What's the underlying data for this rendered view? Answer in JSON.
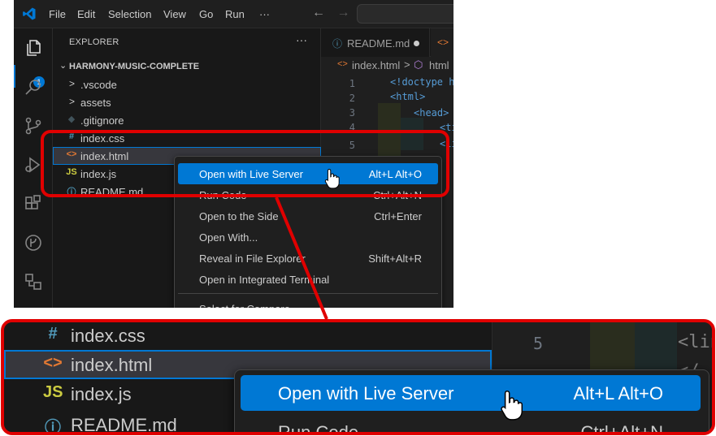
{
  "app": {
    "name": "Visual Studio Code"
  },
  "menubar": {
    "items": [
      {
        "label": "File"
      },
      {
        "label": "Edit"
      },
      {
        "label": "Selection"
      },
      {
        "label": "View"
      },
      {
        "label": "Go"
      },
      {
        "label": "Run"
      },
      {
        "label": "···"
      }
    ],
    "nav_back": "←",
    "nav_forward": "→"
  },
  "activitybar": {
    "icons": [
      "explorer-icon",
      "search-icon",
      "source-control-icon",
      "run-debug-icon",
      "extensions-icon",
      "remote-icon",
      "accounts-icon"
    ],
    "badge": "1"
  },
  "explorer": {
    "title": "EXPLORER",
    "more": "···",
    "project": "HARMONY-MUSIC-COMPLETE",
    "items": [
      {
        "name": ".vscode",
        "kind": "folder",
        "icon": ">",
        "color": "#cccccc"
      },
      {
        "name": "assets",
        "kind": "folder",
        "icon": ">",
        "color": "#cccccc"
      },
      {
        "name": ".gitignore",
        "kind": "file",
        "icon": "◆",
        "color": "#41535b"
      },
      {
        "name": "index.css",
        "kind": "file",
        "icon": "#",
        "color": "#519aba"
      },
      {
        "name": "index.html",
        "kind": "file",
        "icon": "<>",
        "color": "#e37933",
        "selected": true
      },
      {
        "name": "index.js",
        "kind": "file",
        "icon": "JS",
        "color": "#cbcb41"
      },
      {
        "name": "README.md",
        "kind": "file",
        "icon": "ⓘ",
        "color": "#519aba"
      }
    ]
  },
  "editor": {
    "tabs": [
      {
        "label": "README.md",
        "icon": "ⓘ",
        "modified": true
      },
      {
        "label": "",
        "icon": "<>"
      }
    ],
    "breadcrumb": {
      "file": "index.html",
      "separator": ">",
      "symbol": "html"
    },
    "lines": [
      {
        "num": "1",
        "text": "<!doctype htm"
      },
      {
        "num": "2",
        "text": "<html>"
      },
      {
        "num": "3",
        "text": "<head>"
      },
      {
        "num": "4",
        "text": "<tit"
      },
      {
        "num": "5",
        "text": "<lin"
      }
    ]
  },
  "context_menu": {
    "items": [
      {
        "label": "Open with Live Server",
        "shortcut": "Alt+L Alt+O",
        "active": true
      },
      {
        "label": "Run Code",
        "shortcut": "Ctrl+Alt+N"
      },
      {
        "label": "Open to the Side",
        "shortcut": "Ctrl+Enter"
      },
      {
        "label": "Open With...",
        "shortcut": ""
      },
      {
        "label": "Reveal in File Explorer",
        "shortcut": "Shift+Alt+R"
      },
      {
        "label": "Open in Integrated Terminal",
        "shortcut": ""
      },
      {
        "label": "Select for Compare",
        "shortcut": ""
      }
    ]
  },
  "zoom": {
    "rows": [
      {
        "name": "index.css",
        "icon": "#",
        "color": "#519aba"
      },
      {
        "name": "index.html",
        "icon": "<>",
        "color": "#e37933",
        "selected": true
      },
      {
        "name": "index.js",
        "icon": "JS",
        "color": "#cbcb41"
      },
      {
        "name": "README.md",
        "icon": "ⓘ",
        "color": "#519aba"
      }
    ],
    "line_number": "5",
    "code_fragment": "<lin",
    "code_fragment2": "</",
    "menu": [
      {
        "label": "Open with Live Server",
        "shortcut": "Alt+L Alt+O",
        "active": true
      },
      {
        "label": "Run Code",
        "shortcut": "Ctrl+Alt+N"
      }
    ]
  },
  "colors": {
    "accent": "#0078d4",
    "highlight": "#e00000"
  }
}
